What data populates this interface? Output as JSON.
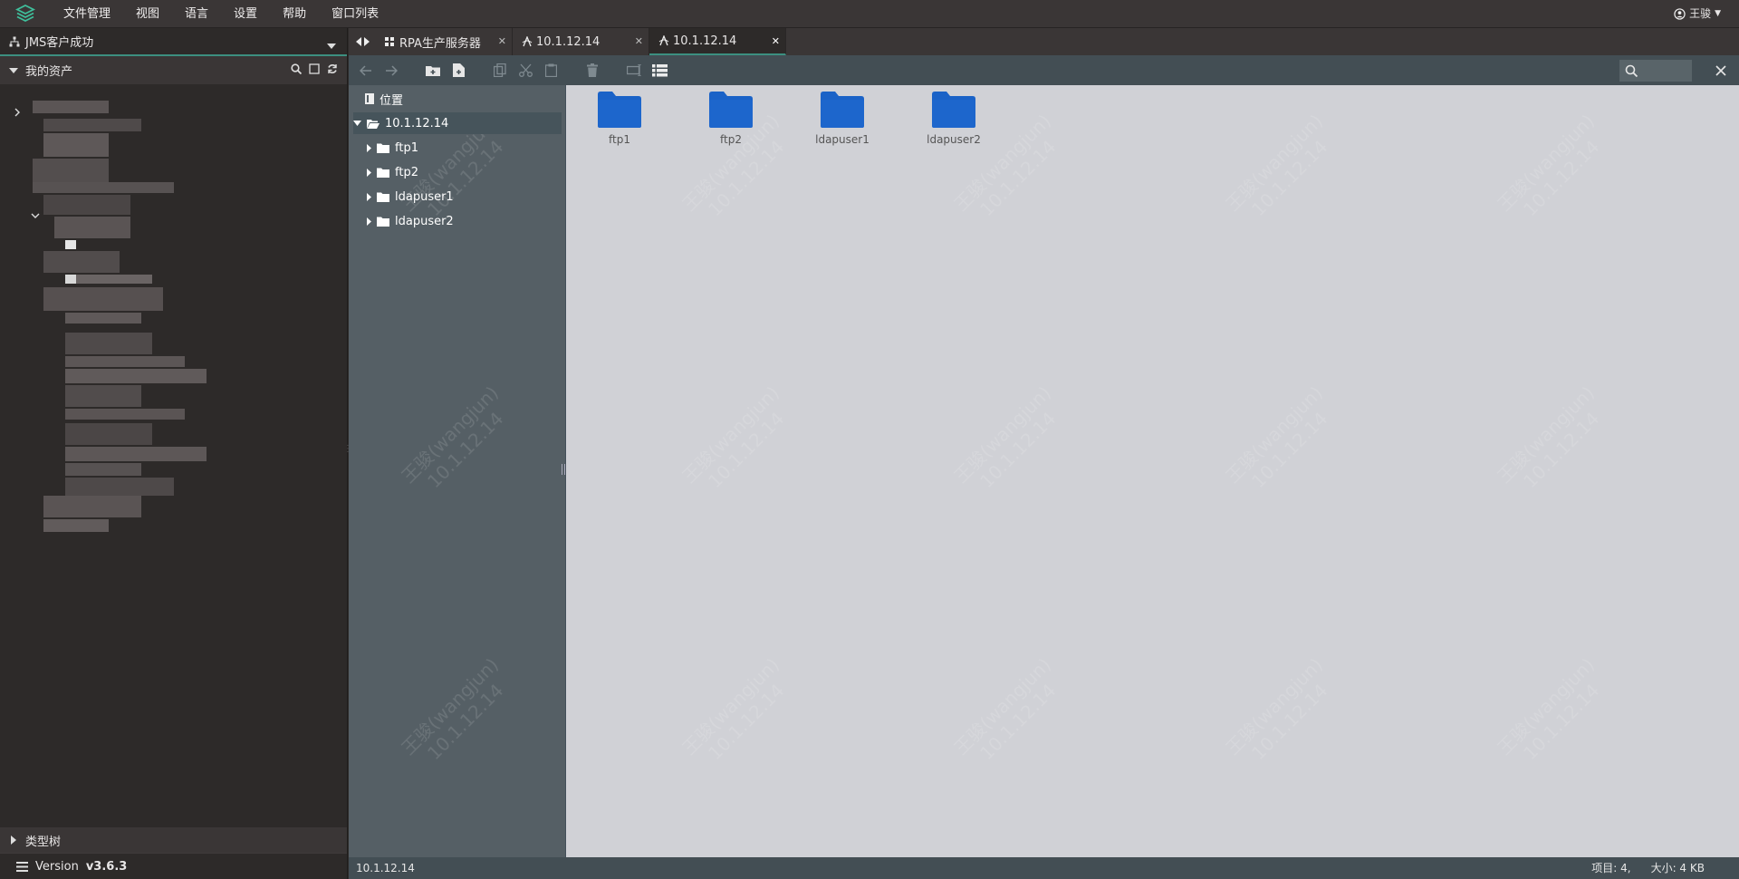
{
  "menubar": {
    "items": [
      "文件管理",
      "视图",
      "语言",
      "设置",
      "帮助",
      "窗口列表"
    ],
    "user": "王骏"
  },
  "left": {
    "connection_status": "JMS客户成功",
    "assets_title": "我的资产",
    "type_tree": "类型树",
    "version_label": "Version",
    "version_value": "v3.6.3"
  },
  "tabs": [
    {
      "label": "RPA生产服务器",
      "icon": "grid-icon",
      "active": false
    },
    {
      "label": "10.1.12.14",
      "icon": "sftp-icon",
      "active": false
    },
    {
      "label": "10.1.12.14",
      "icon": "sftp-icon",
      "active": true
    }
  ],
  "tree": {
    "location": "位置",
    "root": "10.1.12.14",
    "children": [
      "ftp1",
      "ftp2",
      "ldapuser1",
      "ldapuser2"
    ]
  },
  "folders": [
    "ftp1",
    "ftp2",
    "ldapuser1",
    "ldapuser2"
  ],
  "watermark": {
    "line1": "王骏(wangjun)",
    "line2": "10.1.12.14"
  },
  "statusbar": {
    "path": "10.1.12.14",
    "items": "项目: 4,",
    "size": "大小: 4 KB"
  },
  "colors": {
    "accent": "#3c8f80",
    "folder": "#1a62c7",
    "content_bg": "#d0d1d6",
    "tree_bg": "#555f65"
  }
}
